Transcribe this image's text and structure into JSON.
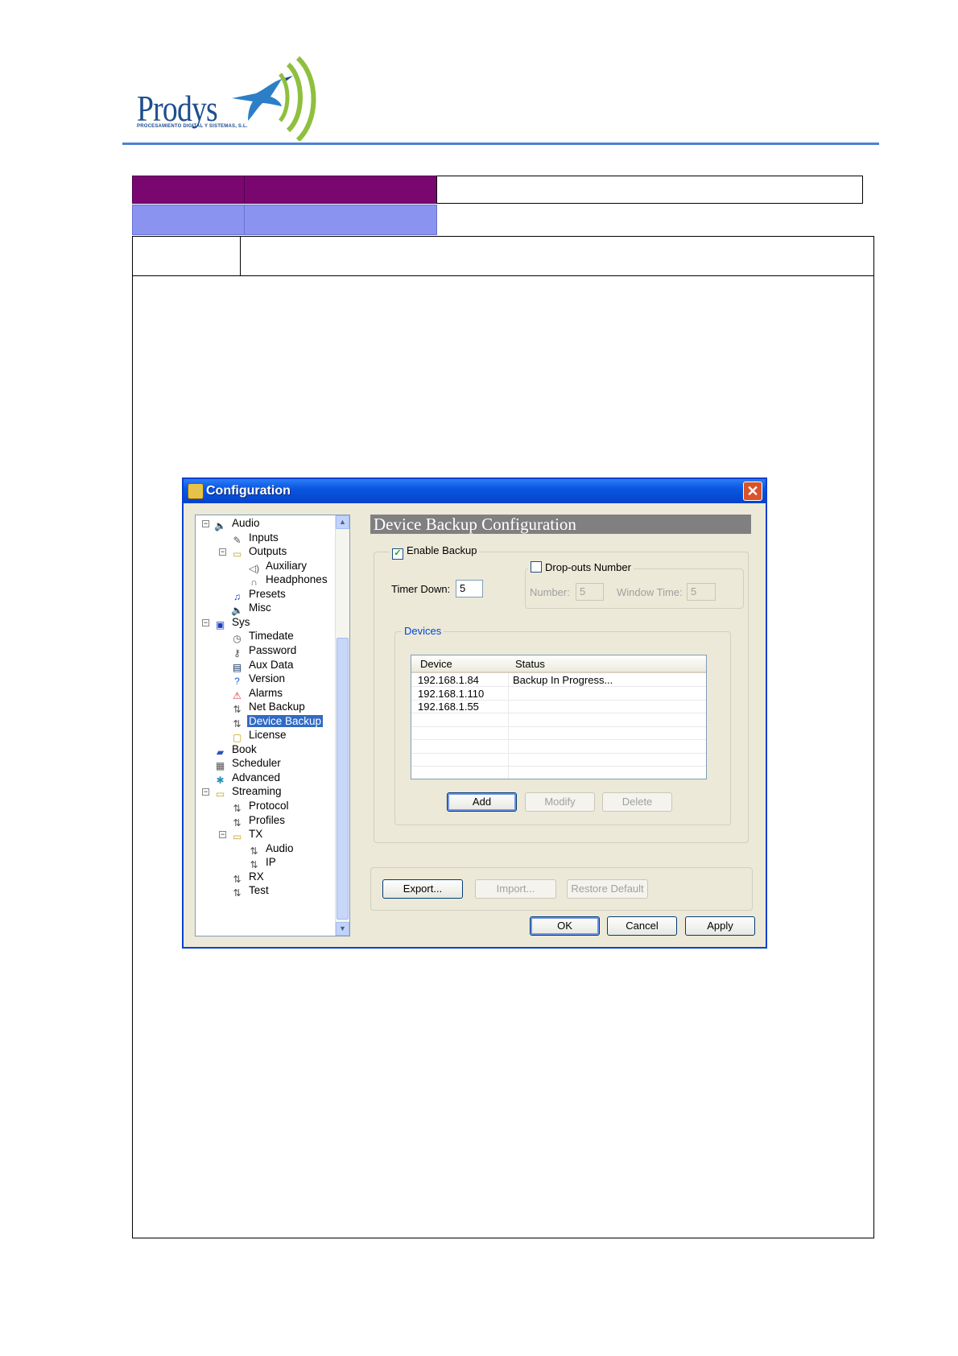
{
  "logo": {
    "name": "Prodys",
    "subtitle": "PROCESAMIENTO DIGITAL Y SISTEMAS, S.L."
  },
  "dialog": {
    "title": "Configuration",
    "close_label": "✕",
    "tree": [
      {
        "label": "Audio",
        "level": 0,
        "icon": "speaker-icon",
        "expand": "−"
      },
      {
        "label": "Inputs",
        "level": 1,
        "icon": "microphone-icon"
      },
      {
        "label": "Outputs",
        "level": 1,
        "icon": "folder-open-icon",
        "expand": "−"
      },
      {
        "label": "Auxiliary",
        "level": 2,
        "icon": "speaker-wave-icon"
      },
      {
        "label": "Headphones",
        "level": 2,
        "icon": "headphones-icon"
      },
      {
        "label": "Presets",
        "level": 1,
        "icon": "music-note-icon"
      },
      {
        "label": "Misc",
        "level": 1,
        "icon": "speaker-icon"
      },
      {
        "label": "Sys",
        "level": 0,
        "icon": "monitor-icon",
        "expand": "−"
      },
      {
        "label": "Timedate",
        "level": 1,
        "icon": "clock-icon"
      },
      {
        "label": "Password",
        "level": 1,
        "icon": "keys-icon"
      },
      {
        "label": "Aux Data",
        "level": 1,
        "icon": "data-icon"
      },
      {
        "label": "Version",
        "level": 1,
        "icon": "help-icon"
      },
      {
        "label": "Alarms",
        "level": 1,
        "icon": "alarm-icon"
      },
      {
        "label": "Net Backup",
        "level": 1,
        "icon": "network-icon"
      },
      {
        "label": "Device Backup",
        "level": 1,
        "icon": "network-icon",
        "selected": true
      },
      {
        "label": "License",
        "level": 1,
        "icon": "lock-icon"
      },
      {
        "label": "Book",
        "level": 0,
        "icon": "book-icon"
      },
      {
        "label": "Scheduler",
        "level": 0,
        "icon": "scheduler-icon"
      },
      {
        "label": "Advanced",
        "level": 0,
        "icon": "gears-icon"
      },
      {
        "label": "Streaming",
        "level": 0,
        "icon": "folder-open-icon",
        "expand": "−"
      },
      {
        "label": "Protocol",
        "level": 1,
        "icon": "network-icon"
      },
      {
        "label": "Profiles",
        "level": 1,
        "icon": "network-icon"
      },
      {
        "label": "TX",
        "level": 1,
        "icon": "folder-open-icon",
        "expand": "−"
      },
      {
        "label": "Audio",
        "level": 2,
        "icon": "network-icon"
      },
      {
        "label": "IP",
        "level": 2,
        "icon": "network-icon"
      },
      {
        "label": "RX",
        "level": 1,
        "icon": "network-icon"
      },
      {
        "label": "Test",
        "level": 1,
        "icon": "network-icon"
      }
    ],
    "panel": {
      "heading": "Device Backup Configuration",
      "enable_backup": "Enable Backup",
      "enable_backup_checked": true,
      "dropouts": "Drop-outs Number",
      "dropouts_checked": false,
      "timer_down_label": "Timer Down:",
      "timer_down_value": "5",
      "number_label": "Number:",
      "number_value": "5",
      "window_time_label": "Window Time:",
      "window_time_value": "5",
      "devices_title": "Devices",
      "columns": [
        "Device",
        "Status"
      ],
      "rows": [
        {
          "device": "192.168.1.84",
          "status": "Backup In Progress..."
        },
        {
          "device": "192.168.1.110",
          "status": ""
        },
        {
          "device": "192.168.1.55",
          "status": ""
        }
      ],
      "add": "Add",
      "modify": "Modify",
      "delete": "Delete"
    },
    "export": "Export...",
    "import": "Import...",
    "restore": "Restore Default",
    "ok": "OK",
    "cancel": "Cancel",
    "apply": "Apply"
  }
}
